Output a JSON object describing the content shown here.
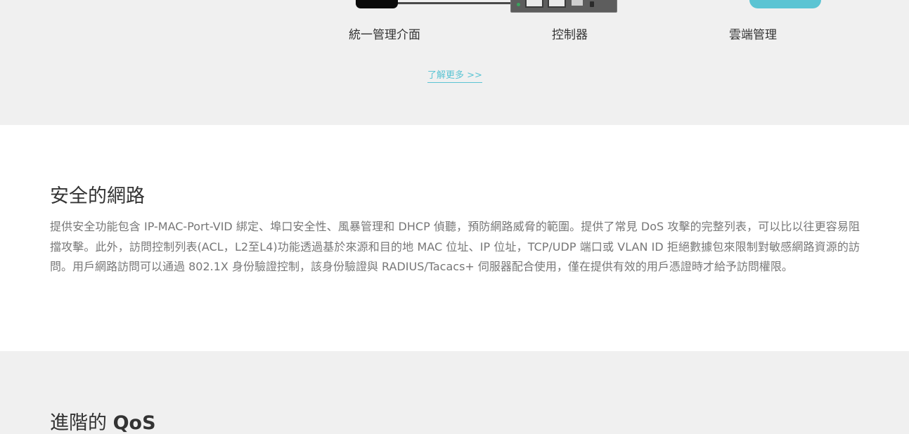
{
  "features": {
    "ui_label": "統一管理介面",
    "controller_label": "控制器",
    "cloud_label": "雲端管理"
  },
  "learn_more": "了解更多 >>",
  "security": {
    "title": "安全的網路",
    "body": "提供安全功能包含 IP-MAC-Port-VID 綁定、埠口安全性、風暴管理和 DHCP 偵聽，預防網路威脅的範圍。提供了常見 DoS 攻擊的完整列表，可以比以往更容易阻擋攻擊。此外，訪問控制列表(ACL，L2至L4)功能透過基於來源和目的地 MAC 位址、IP 位址，TCP/UDP 端口或 VLAN ID 拒絕數據包來限制對敏感網路資源的訪問。用戶網路訪問可以通過 802.1X 身份驗證控制，該身份驗證與 RADIUS/Tacacs+ 伺服器配合使用，僅在提供有效的用戶憑證時才給予訪問權限。"
  },
  "qos": {
    "title_prefix": "進階的 ",
    "title_bold": "QoS"
  },
  "colors": {
    "accent": "#5bc4d3",
    "band_bg": "#f0f0f0",
    "body_text": "#777777",
    "heading_text": "#333333"
  }
}
